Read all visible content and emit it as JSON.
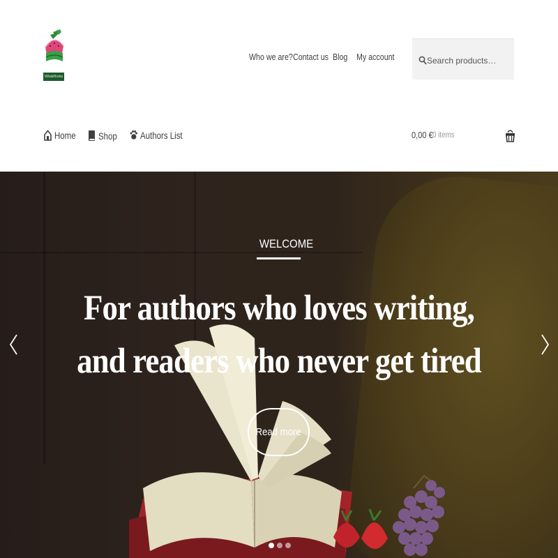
{
  "brand": {
    "name": "WhaleBooks",
    "logo_icon": "watermelon-book-logo"
  },
  "secondary_nav": {
    "items": [
      {
        "label": "Who we are?"
      },
      {
        "label": "Contact us"
      },
      {
        "label": "Blog"
      },
      {
        "label": "My account"
      }
    ]
  },
  "search": {
    "placeholder": "Search products…",
    "value": "",
    "icon": "search-icon"
  },
  "primary_nav": {
    "items": [
      {
        "label": "Home",
        "icon": "home-icon"
      },
      {
        "label": "Shop",
        "icon": "book-icon"
      },
      {
        "label": "Authors List",
        "icon": "paw-icon"
      }
    ]
  },
  "cart": {
    "amount": "0,00 €",
    "items": "0 items",
    "icon": "basket-icon"
  },
  "hero": {
    "kicker": "WELCOME",
    "headline": "For authors who loves writing, and readers who never get tired",
    "cta_label": "Read more",
    "prev_icon": "chevron-left-icon",
    "next_icon": "chevron-right-icon",
    "slides_count": 3,
    "active_slide": 1
  },
  "colors": {
    "text": "#404040",
    "muted": "#9a9a9a",
    "search_bg": "#f2f2f2",
    "hero_text": "#ffffff",
    "logo_green": "#1f5a2c",
    "logo_pink": "#e0457b"
  }
}
